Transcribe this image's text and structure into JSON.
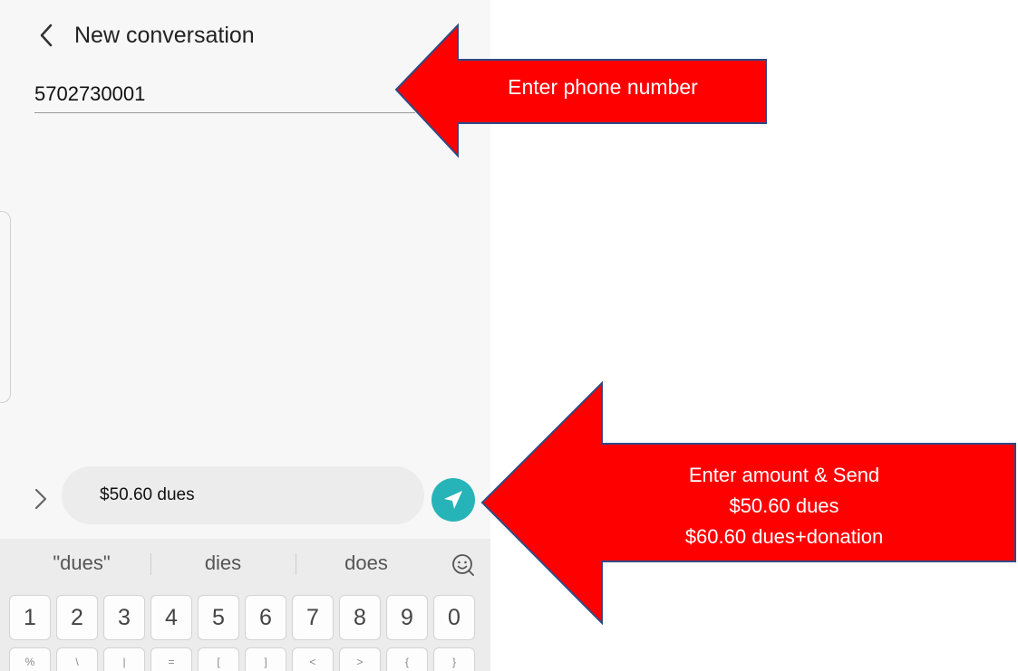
{
  "header": {
    "title": "New conversation"
  },
  "recipient": {
    "value": "5702730001"
  },
  "composer": {
    "message": "$50.60 dues"
  },
  "keyboard": {
    "suggestions": [
      "\"dues\"",
      "dies",
      "does"
    ],
    "number_row": [
      "1",
      "2",
      "3",
      "4",
      "5",
      "6",
      "7",
      "8",
      "9",
      "0"
    ],
    "symbol_row": [
      "%",
      "\\",
      "|",
      "=",
      "[",
      "]",
      "<",
      ">",
      "{",
      "}"
    ]
  },
  "annotations": {
    "phone_callout": "Enter phone number",
    "send_callout": {
      "line1": "Enter amount & Send",
      "line2": "$50.60 dues",
      "line3": "$60.60 dues+donation"
    },
    "arrow_color": "#ff0000",
    "arrow_outline": "#2f4a86"
  },
  "colors": {
    "send_button": "#27b4b8",
    "screen_background": "#f7f7f7"
  },
  "icons": {
    "back": "chevron-left-icon",
    "expand": "chevron-right-icon",
    "send": "paper-plane-icon",
    "emoji": "smiley-icon"
  }
}
